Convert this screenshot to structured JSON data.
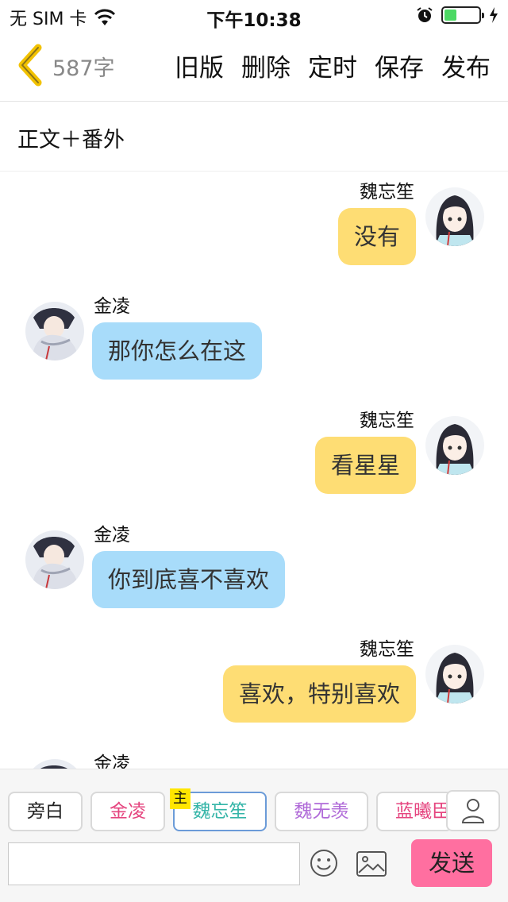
{
  "status_bar": {
    "carrier": "无 SIM 卡",
    "time": "下午10:38",
    "battery_level": 0.35
  },
  "nav": {
    "word_count": "587字",
    "actions": [
      "旧版",
      "删除",
      "定时",
      "保存",
      "发布"
    ]
  },
  "chapter": {
    "title": "正文＋番外"
  },
  "messages": [
    {
      "speaker": "魏忘笙",
      "side": "right",
      "text": "没有"
    },
    {
      "speaker": "金凌",
      "side": "left",
      "text": "那你怎么在这"
    },
    {
      "speaker": "魏忘笙",
      "side": "right",
      "text": "看星星"
    },
    {
      "speaker": "金凌",
      "side": "left",
      "text": "你到底喜不喜欢"
    },
    {
      "speaker": "魏忘笙",
      "side": "right",
      "text": "喜欢，特别喜欢"
    },
    {
      "speaker": "金凌",
      "side": "left",
      "text": ""
    }
  ],
  "roles": {
    "main_badge": "主",
    "chips": [
      {
        "label": "旁白",
        "color": "#222222"
      },
      {
        "label": "金凌",
        "color": "#e5457f"
      },
      {
        "label": "魏忘笙",
        "color": "#35b5a8"
      },
      {
        "label": "魏无羡",
        "color": "#b06ad8"
      },
      {
        "label": "蓝曦臣",
        "color": "#e5457f"
      }
    ]
  },
  "composer": {
    "input_value": "",
    "send_label": "发送"
  },
  "colors": {
    "bubble_right": "#fedd74",
    "bubble_left": "#a8dcfa",
    "send": "#ff6fa0",
    "back_chevron": "#f2c200"
  }
}
